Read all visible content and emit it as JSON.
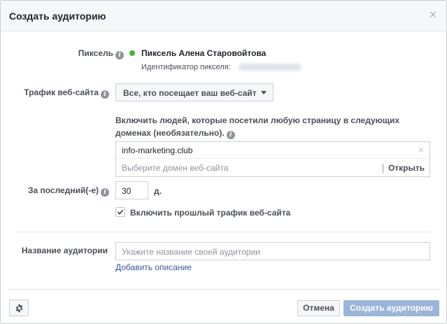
{
  "dialog": {
    "title": "Создать аудиторию",
    "close_glyph": "×"
  },
  "pixel": {
    "label": "Пиксель",
    "name": "Пиксель Алена Старовойтова",
    "id_label": "Идентификатор пикселя:",
    "status_color": "#42b72a"
  },
  "traffic": {
    "label": "Трафик веб-сайта",
    "selected": "Все, кто посещает ваш веб-сайт"
  },
  "include": {
    "text": "Включить людей, которые посетили любую страницу в следующих доменах (необязательно)."
  },
  "domains": {
    "values": [
      "info-marketing.club"
    ],
    "remove_glyph": "×",
    "placeholder": "Выберите домен веб-сайта",
    "open_label": "Открыть"
  },
  "period": {
    "label": "За последний(-е)",
    "value": "30",
    "unit": "д."
  },
  "past_traffic": {
    "label": "Включить прошлый трафик веб-сайта",
    "checked": true
  },
  "audience_name": {
    "label": "Название аудитории",
    "placeholder": "Укажите название своей аудитории",
    "add_description": "Добавить описание"
  },
  "footer": {
    "cancel_label": "Отмена",
    "create_label": "Создать аудиторию",
    "settings_icon": "gear-icon",
    "primary_color": "#9cb4d8"
  },
  "info_glyph": "i"
}
